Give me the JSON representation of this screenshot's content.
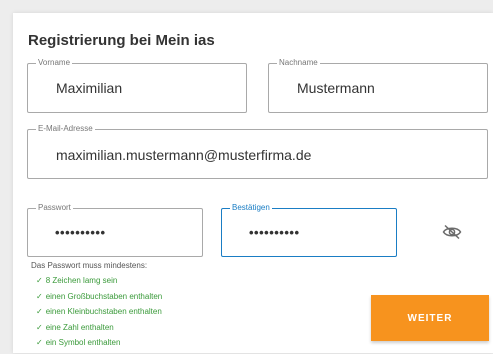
{
  "title": "Registrierung bei Mein ias",
  "fields": {
    "vorname": {
      "label": "Vorname",
      "value": "Maximilian"
    },
    "nachname": {
      "label": "Nachname",
      "value": "Mustermann"
    },
    "email": {
      "label": "E-Mail-Adresse",
      "value": "maximilian.mustermann@musterfirma.de"
    },
    "passwort": {
      "label": "Passwort",
      "value": "••••••••••"
    },
    "bestaetigen": {
      "label": "Bestätigen",
      "value": "••••••••••"
    }
  },
  "password_rules": {
    "title": "Das Passwort muss mindestens:",
    "check_glyph": "✓",
    "items": [
      "8 Zeichen lamg sein",
      "einen Großbuchstaben enthalten",
      "einen Kleinbuchstaben enthalten",
      "eine Zahl enthalten",
      "ein Symbol enthalten"
    ]
  },
  "visibility_toggle_icon": "eye-off-icon",
  "submit_label": "WEITER",
  "colors": {
    "accent": "#f7931e",
    "focus": "#1a7dc4",
    "success": "#3a9a3a"
  }
}
